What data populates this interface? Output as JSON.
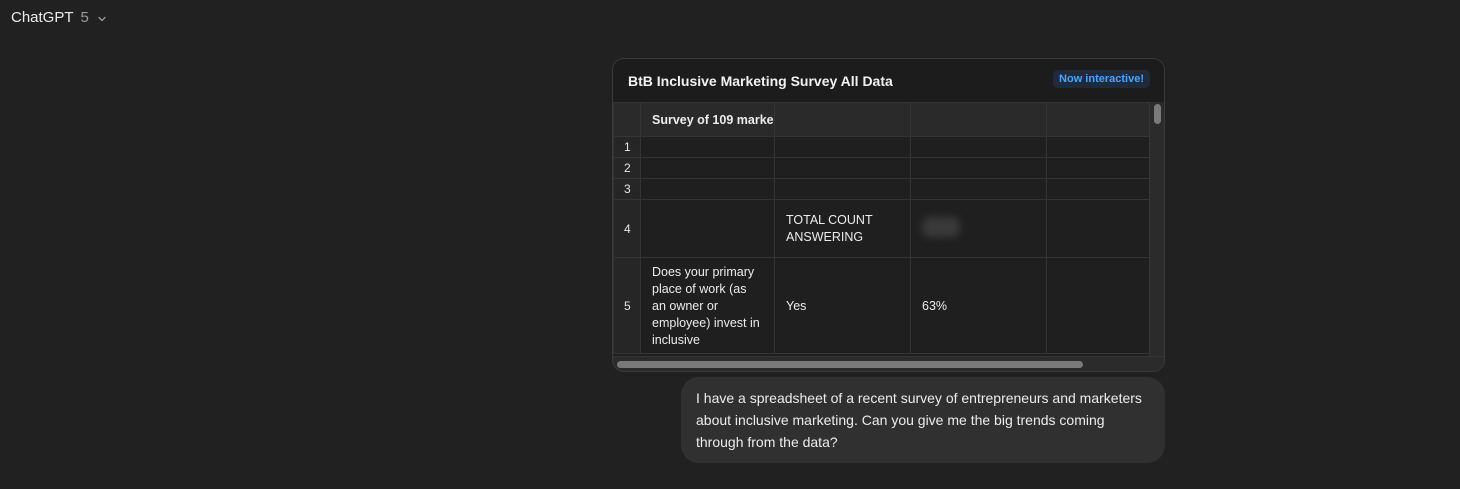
{
  "header": {
    "model_name": "ChatGPT",
    "model_version": "5",
    "dropdown_icon": "chevron-down-icon"
  },
  "sheet": {
    "title": "BtB Inclusive Marketing Survey All Data",
    "badge": "Now interactive!",
    "header_row": [
      "",
      "Survey of 109 marke",
      "",
      "",
      ""
    ],
    "rows": [
      {
        "num": "1",
        "cells": [
          "",
          "",
          "",
          ""
        ]
      },
      {
        "num": "2",
        "cells": [
          "",
          "",
          "",
          ""
        ]
      },
      {
        "num": "3",
        "cells": [
          "",
          "",
          "",
          ""
        ]
      },
      {
        "num": "4",
        "cells": [
          "",
          "TOTAL COUNT ANSWERING",
          "",
          ""
        ]
      },
      {
        "num": "5",
        "cells": [
          "Does your primary place of work (as an owner or employee) invest in inclusive",
          "Yes",
          "63%",
          ""
        ]
      }
    ]
  },
  "user_message": {
    "text": "I have a spreadsheet of a recent survey of entrepreneurs and marketers about inclusive marketing. Can you give me the big trends coming through from the data?"
  }
}
